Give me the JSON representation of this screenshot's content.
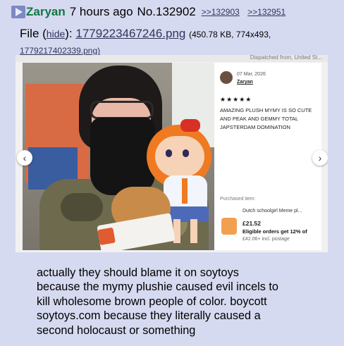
{
  "post": {
    "name": "Zaryan",
    "date": "7 hours ago",
    "number": "No.132902",
    "backlinks": [
      ">>132903",
      ">>132951"
    ]
  },
  "file": {
    "label": "File",
    "hide": "hide",
    "filename": "1779223467246.png",
    "meta": "(450.78 KB, 774x493,",
    "original": "1779217402339.png)"
  },
  "screenshot": {
    "top_strip": "Dispatched from, United St...",
    "review": {
      "date": "07 Mar, 2026",
      "user": "Zaryan",
      "stars": "★★★★★",
      "text": "AMAZING PLUSH MYMY IS SO CUTE AND PEAK AND GEMMY TOTAL JAPSTERDAM DOMINATION",
      "purchased_label": "Purchased item:",
      "product_name": "Dutch schoolgirl Meme pl...",
      "price": "£21.52",
      "eligible": "Eligible orders get 12% of",
      "postage": "£42.06+ incl. postage"
    },
    "arrow_left": "‹",
    "arrow_right": "›"
  },
  "comment_lines": [
    "actually they should blame it on soytoys",
    "because the mymy plushie caused evil incels to",
    "kill wholesome brown people of color. boycott",
    "soytoys.com because they literally caused a",
    "second holocaust or something"
  ]
}
